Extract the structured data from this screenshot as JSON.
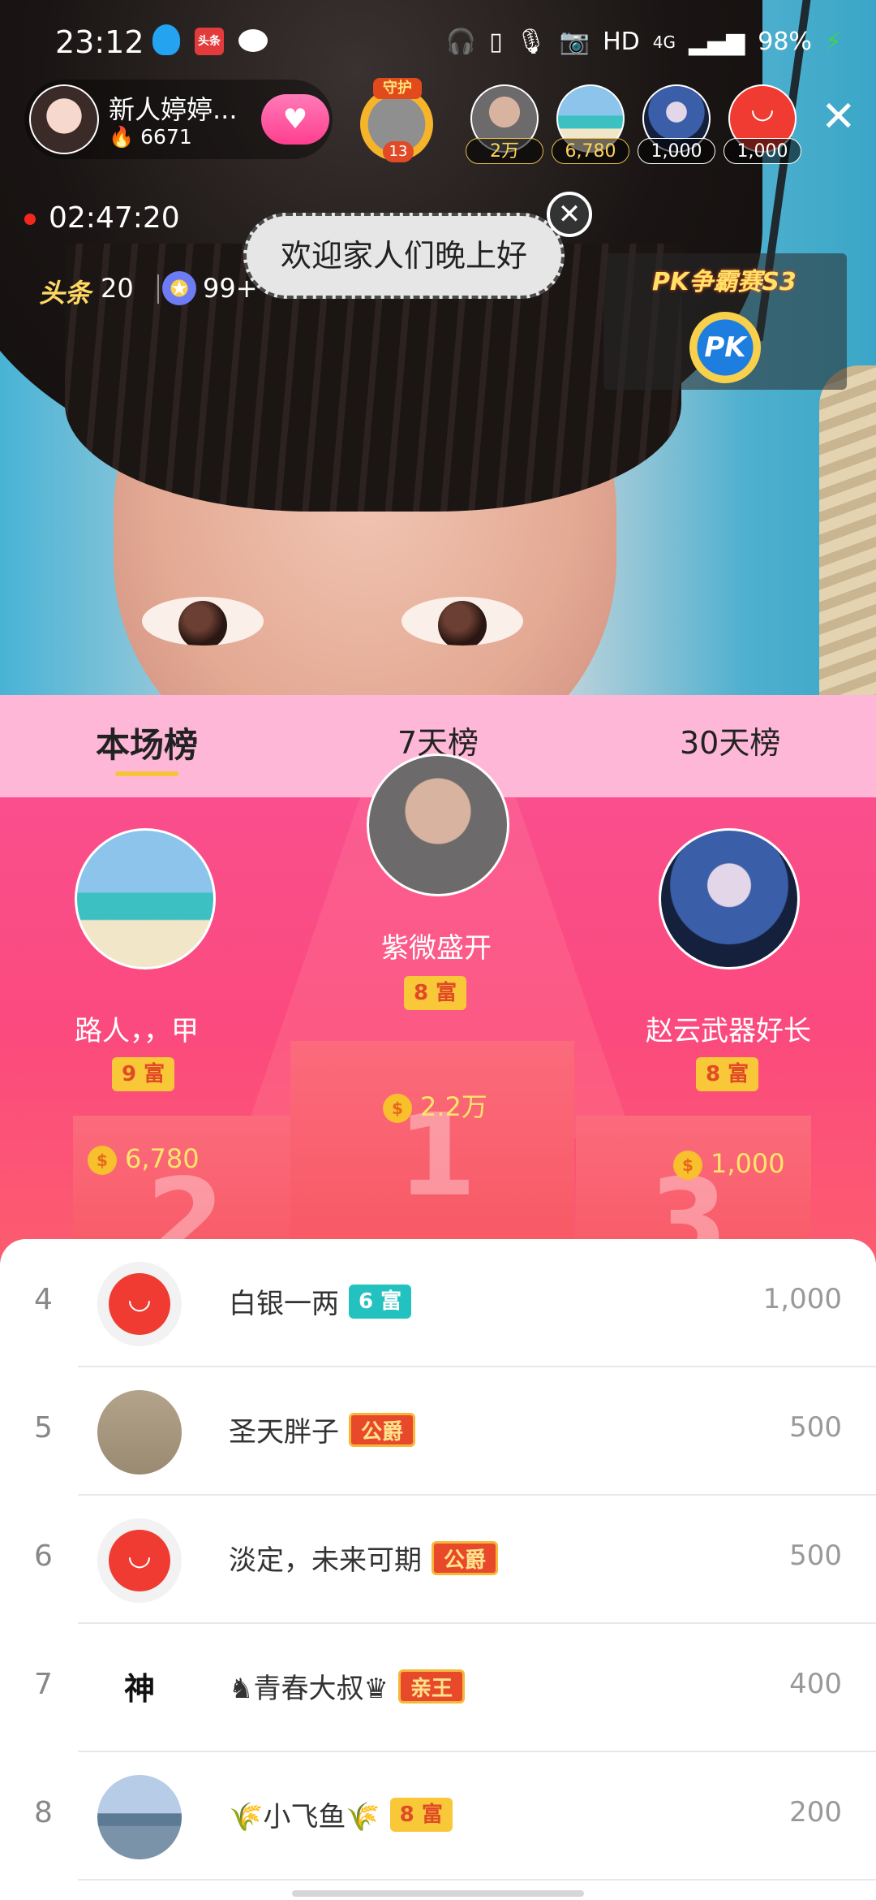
{
  "status_bar": {
    "time": "23:12",
    "app_icons": [
      "qq-icon",
      "toutiao-icon",
      "wechat-icon"
    ],
    "toutiao_label": "头条",
    "right": [
      "headphones-icon",
      "vibrate-icon",
      "mic-icon",
      "camera-icon"
    ],
    "hd": "HD",
    "network": "4G",
    "battery": "98%"
  },
  "host": {
    "name": "新人婷婷...",
    "heat": "6671",
    "follow_icon": "heart-wings-icon"
  },
  "guard": {
    "tag": "守护",
    "level": "13"
  },
  "viewers": [
    {
      "count": "2万"
    },
    {
      "count": "6,780"
    },
    {
      "count": "1,000"
    },
    {
      "count": "1,000"
    }
  ],
  "live": {
    "timer": "02:47:20"
  },
  "stats": {
    "toutiao_label": "头条",
    "toutiao_count": "20",
    "star_count": "99+"
  },
  "bubble": {
    "text": "欢迎家人们晚上好"
  },
  "pk": {
    "title": "PK争霸赛S3",
    "button": "PK"
  },
  "tabs": [
    {
      "label": "本场榜",
      "active": true
    },
    {
      "label": "7天榜",
      "active": false
    },
    {
      "label": "30天榜",
      "active": false
    }
  ],
  "podium": {
    "first": {
      "name": "紫微盛开",
      "rich": "8 富",
      "coins": "2.2万",
      "rank": "1"
    },
    "second": {
      "name": "路人，，甲",
      "rich": "9 富",
      "coins": "6,780",
      "rank": "2"
    },
    "third": {
      "name": "赵云武器好长",
      "rich": "8 富",
      "coins": "1,000",
      "rank": "3"
    }
  },
  "list": [
    {
      "rank": "4",
      "name": "白银一两",
      "tag": "6 富",
      "tag_style": "teal",
      "score": "1,000"
    },
    {
      "rank": "5",
      "name": "圣天胖子",
      "tag": "公爵",
      "tag_style": "red",
      "score": "500"
    },
    {
      "rank": "6",
      "name": "淡定，未来可期",
      "tag": "公爵",
      "tag_style": "red",
      "score": "500"
    },
    {
      "rank": "7",
      "name": "♞青春大叔♛",
      "tag": "亲王",
      "tag_style": "red",
      "score": "400"
    },
    {
      "rank": "8",
      "name": "🌾小飞鱼🌾",
      "tag": "8 富",
      "tag_style": "gold",
      "score": "200"
    }
  ],
  "list_avatar_char": "神",
  "colors": {
    "tabs_bg": "#feb7d7",
    "podium_bg": "#fa4f8d",
    "rich_gold": "#f8c839",
    "accent_teal": "#23c2c0"
  }
}
